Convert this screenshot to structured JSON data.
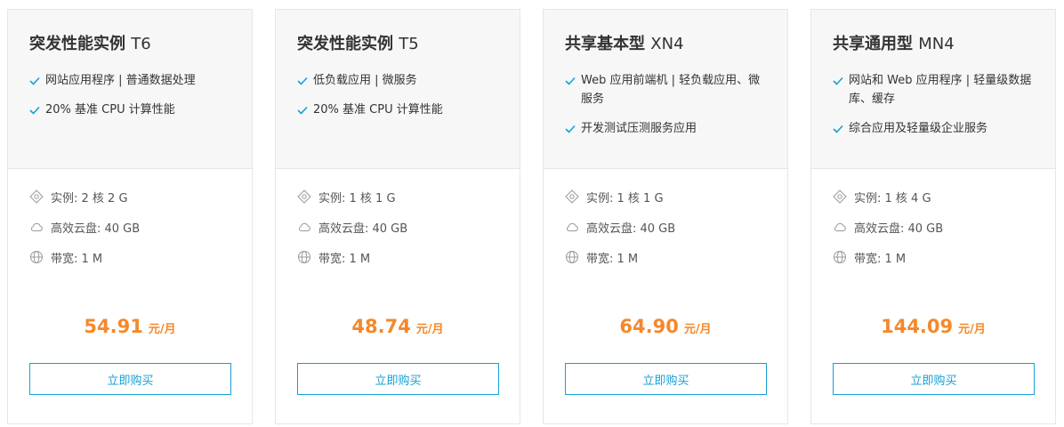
{
  "colors": {
    "accent": "#16a0d6",
    "price": "#f5882a",
    "check": "#16a0d6"
  },
  "cards": [
    {
      "name": "突发性能实例",
      "model": "T6",
      "features": [
        "网站应用程序 | 普通数据处理",
        "20% 基准 CPU 计算性能"
      ],
      "spec_instance": "实例: 2 核 2 G",
      "spec_disk": "高效云盘: 40 GB",
      "spec_bandwidth": "带宽: 1 M",
      "price": "54.91",
      "unit": "元/月",
      "button": "立即购买"
    },
    {
      "name": "突发性能实例",
      "model": "T5",
      "features": [
        "低负载应用 | 微服务",
        "20% 基准 CPU 计算性能"
      ],
      "spec_instance": "实例: 1 核 1 G",
      "spec_disk": "高效云盘: 40 GB",
      "spec_bandwidth": "带宽: 1 M",
      "price": "48.74",
      "unit": "元/月",
      "button": "立即购买"
    },
    {
      "name": "共享基本型",
      "model": "XN4",
      "features": [
        "Web 应用前端机 | 轻负载应用、微服务",
        "开发测试压测服务应用"
      ],
      "spec_instance": "实例: 1 核 1 G",
      "spec_disk": "高效云盘: 40 GB",
      "spec_bandwidth": "带宽: 1 M",
      "price": "64.90",
      "unit": "元/月",
      "button": "立即购买"
    },
    {
      "name": "共享通用型",
      "model": "MN4",
      "features": [
        "网站和 Web 应用程序 | 轻量级数据库、缓存",
        "综合应用及轻量级企业服务"
      ],
      "spec_instance": "实例: 1 核 4 G",
      "spec_disk": "高效云盘: 40 GB",
      "spec_bandwidth": "带宽: 1 M",
      "price": "144.09",
      "unit": "元/月",
      "button": "立即购买"
    }
  ]
}
